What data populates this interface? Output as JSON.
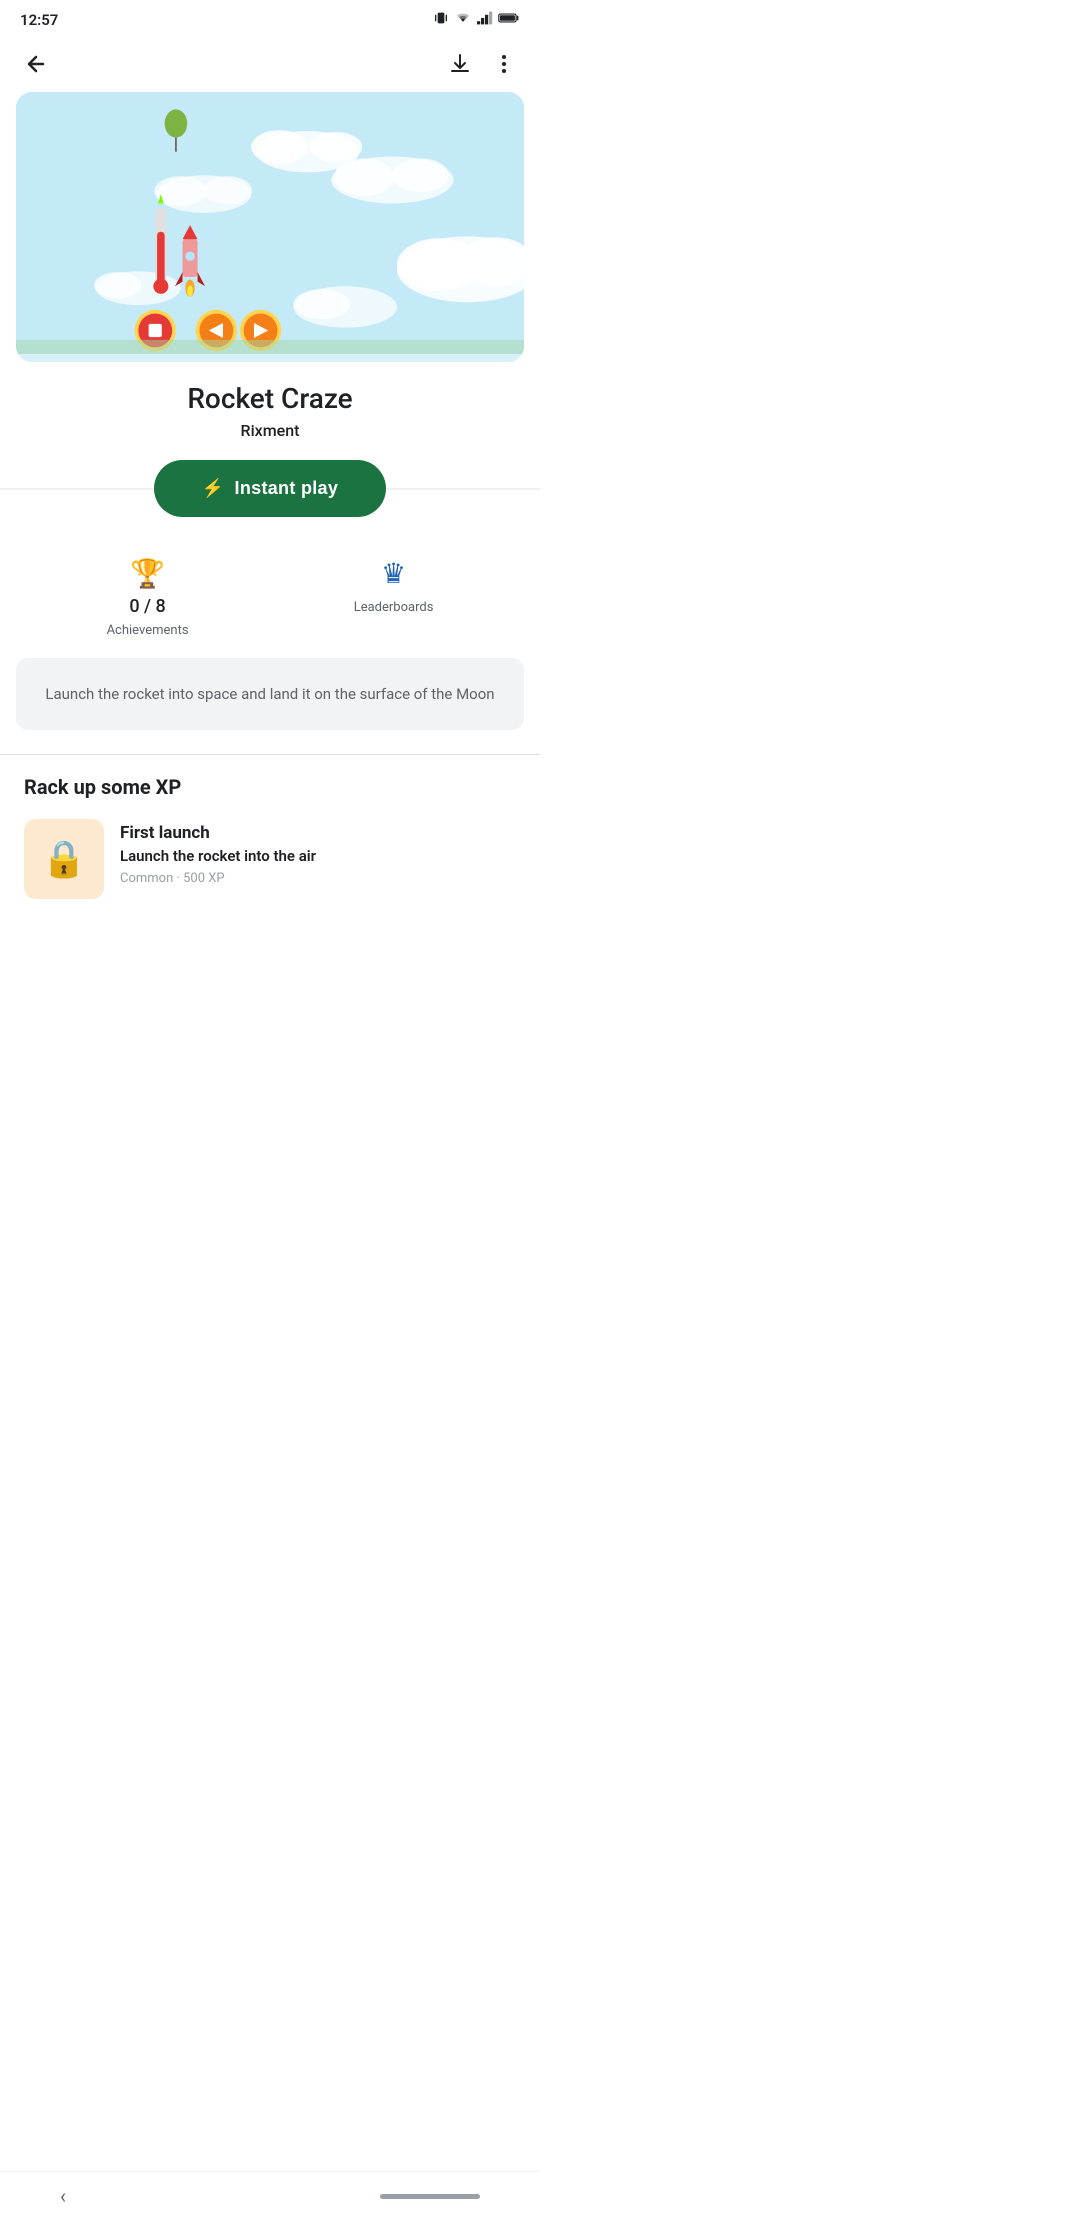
{
  "statusBar": {
    "time": "12:57",
    "icons": [
      "vibrate",
      "wifi",
      "signal",
      "battery"
    ]
  },
  "nav": {
    "backLabel": "←",
    "downloadLabel": "⬇",
    "moreLabel": "⋮"
  },
  "app": {
    "title": "Rocket Craze",
    "developer": "Rixment",
    "instantPlayLabel": "Instant play",
    "achievements": {
      "count": "0 / 8",
      "label": "Achievements"
    },
    "leaderboards": {
      "label": "Leaderboards"
    },
    "description": "Launch the rocket into space and land it on the surface of the Moon"
  },
  "xpSection": {
    "title": "Rack up some XP",
    "achievements": [
      {
        "name": "First launch",
        "description": "Launch the rocket into the air",
        "meta": "Common · 500 XP"
      }
    ]
  },
  "colors": {
    "instantPlayBg": "#1a7340",
    "leaderboardsIcon": "#1a7340",
    "achievementIconBg": "#fde8d0"
  }
}
